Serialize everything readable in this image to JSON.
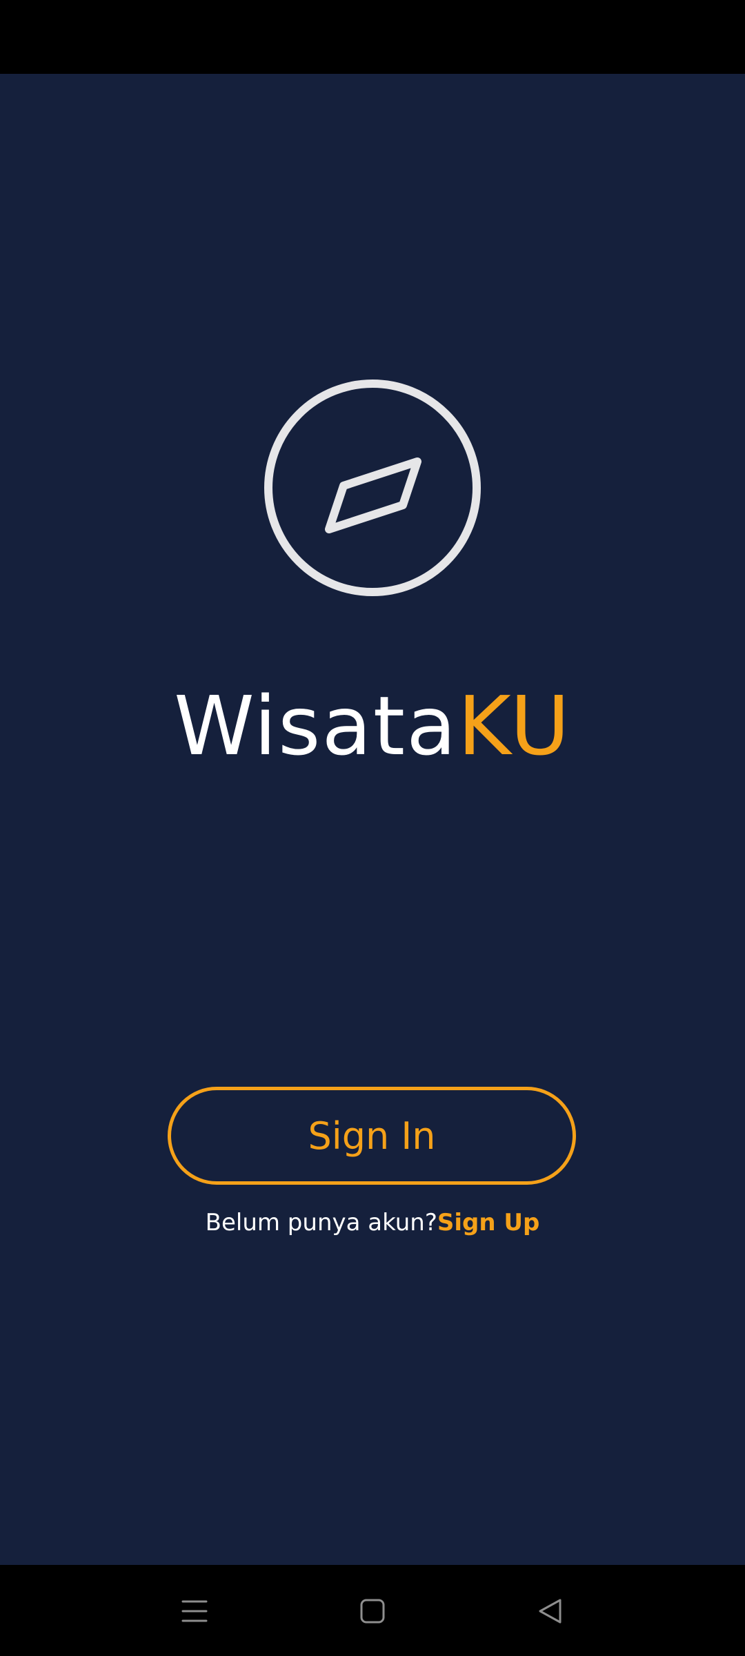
{
  "app": {
    "name_part1": "Wisata",
    "name_part2": "KU",
    "logo_icon": "compass-icon"
  },
  "auth": {
    "sign_in_label": "Sign In",
    "signup_prompt": "Belum punya akun?",
    "signup_link": "Sign Up"
  },
  "system_nav": {
    "items": [
      "menu-icon",
      "home-icon",
      "back-icon"
    ]
  },
  "colors": {
    "background": "#15203C",
    "accent": "#F5A119",
    "text": "#FFFFFF",
    "icon": "#E6E6E8"
  }
}
